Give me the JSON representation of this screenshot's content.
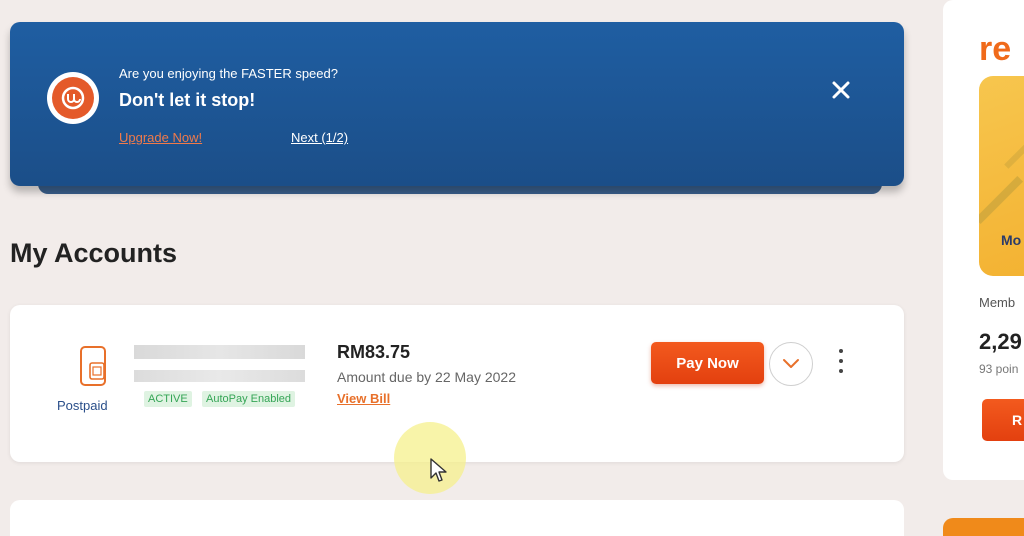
{
  "banner": {
    "question": "Are you enjoying the FASTER speed?",
    "headline": "Don't let it stop!",
    "upgrade_link": "Upgrade Now!",
    "next_link": "Next (1/2)",
    "close_icon": "close-icon",
    "logo_icon": "unifi-logo-icon"
  },
  "section": {
    "title": "My Accounts"
  },
  "account": {
    "plan_type": "Postpaid",
    "plan_icon": "mobile-sim-icon",
    "status_badge": "ACTIVE",
    "autopay_badge": "AutoPay Enabled",
    "amount": "RM83.75",
    "due_text": "Amount due by 22 May 2022",
    "view_bill": "View Bill",
    "pay_button": "Pay Now",
    "expand_icon": "chevron-down-icon",
    "more_icon": "more-vertical-icon"
  },
  "side": {
    "brand": "re",
    "card_text": "Mo",
    "member_label": "Memb",
    "points": "2,29",
    "points_sub": "93 poin",
    "button_label": "R"
  },
  "colors": {
    "banner_bg": "#1b4e88",
    "accent_orange": "#e3400f",
    "badge_green": "#35a556",
    "link_orange": "#e8702a"
  }
}
